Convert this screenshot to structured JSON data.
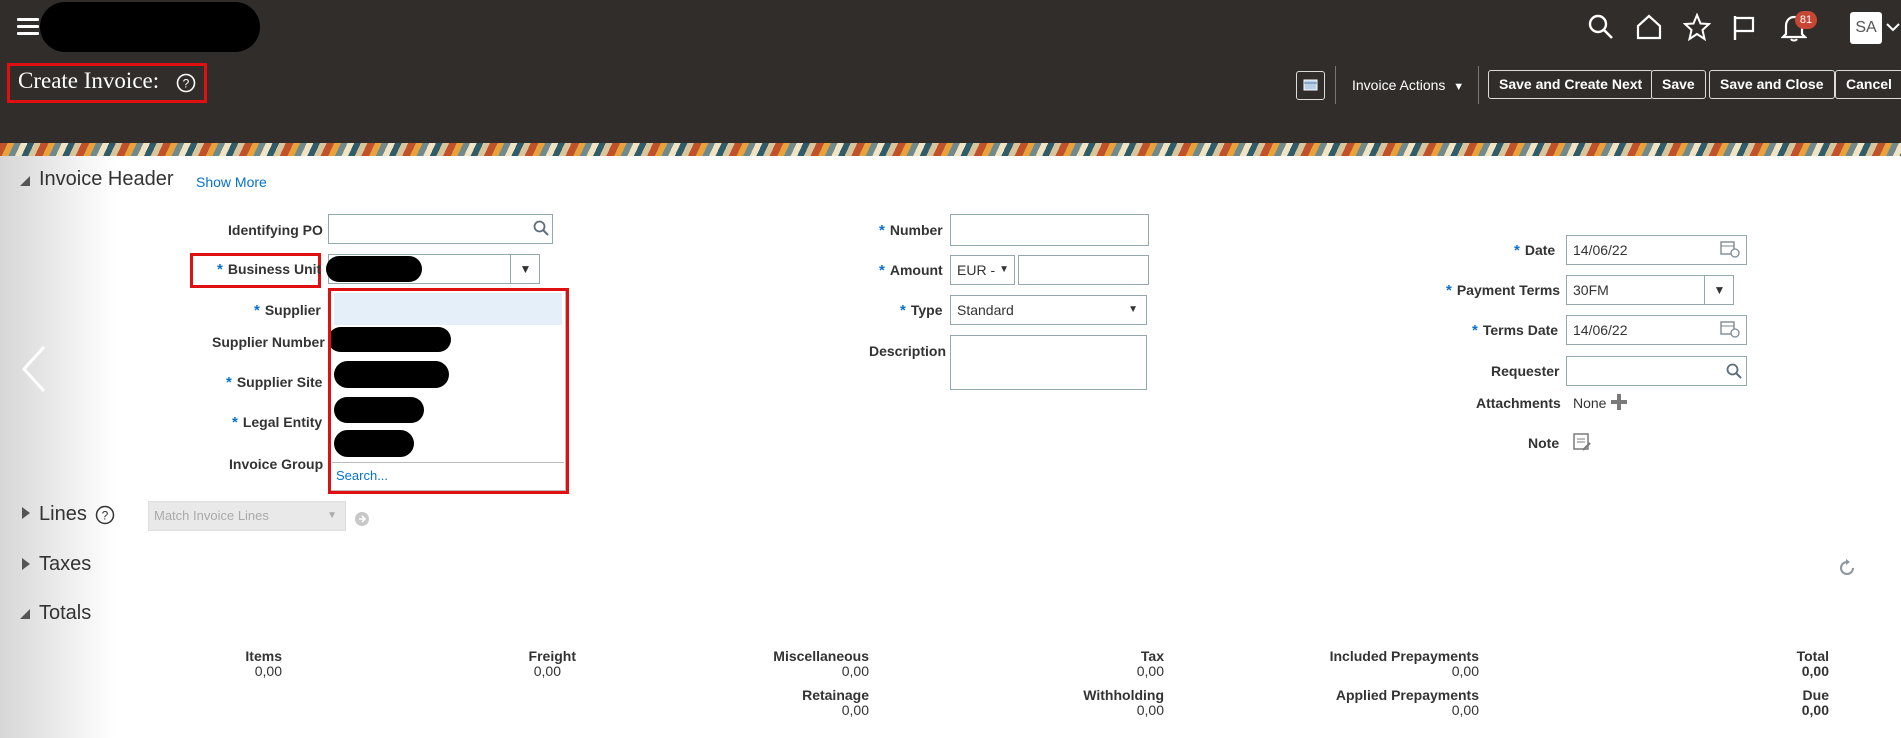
{
  "header": {
    "title": "Create Invoice:",
    "notifications_count": "81",
    "user_initials": "SA",
    "invoice_actions_label": "Invoice Actions",
    "buttons": {
      "save_and_create_next": "Save and Create Next",
      "save": "Save",
      "save_and_close": "Save and Close",
      "cancel": "Cancel"
    }
  },
  "invoice_header": {
    "section_title": "Invoice Header",
    "show_more": "Show More",
    "labels": {
      "identifying_po": "Identifying PO",
      "business_unit": "Business Unit",
      "supplier": "Supplier",
      "supplier_number": "Supplier Number",
      "supplier_site": "Supplier Site",
      "legal_entity": "Legal Entity",
      "invoice_group": "Invoice Group",
      "number": "Number",
      "amount": "Amount",
      "type": "Type",
      "description": "Description",
      "date": "Date",
      "payment_terms": "Payment Terms",
      "terms_date": "Terms Date",
      "requester": "Requester",
      "attachments": "Attachments",
      "note": "Note"
    },
    "values": {
      "currency": "EUR -",
      "type": "Standard",
      "date": "14/06/22",
      "payment_terms": "30FM",
      "terms_date": "14/06/22",
      "attachments": "None"
    },
    "dropdown": {
      "search_link": "Search..."
    }
  },
  "lines": {
    "section_title": "Lines",
    "match_placeholder": "Match Invoice Lines"
  },
  "taxes": {
    "section_title": "Taxes"
  },
  "totals": {
    "section_title": "Totals",
    "items": [
      {
        "label": "Items",
        "value": "0,00"
      },
      {
        "label": "Freight",
        "value": "0,00"
      },
      {
        "label": "Miscellaneous",
        "value": "0,00"
      },
      {
        "label": "Tax",
        "value": "0,00"
      },
      {
        "label": "Included Prepayments",
        "value": "0,00"
      },
      {
        "label": "Total",
        "value": "0,00"
      },
      {
        "label": "Retainage",
        "value": "0,00"
      },
      {
        "label": "Withholding",
        "value": "0,00"
      },
      {
        "label": "Applied Prepayments",
        "value": "0,00"
      },
      {
        "label": "Due",
        "value": "0,00"
      }
    ]
  },
  "colors": {
    "top_bar": "#312d2a",
    "accent_link": "#0572ce",
    "highlight_box": "#e01010"
  }
}
